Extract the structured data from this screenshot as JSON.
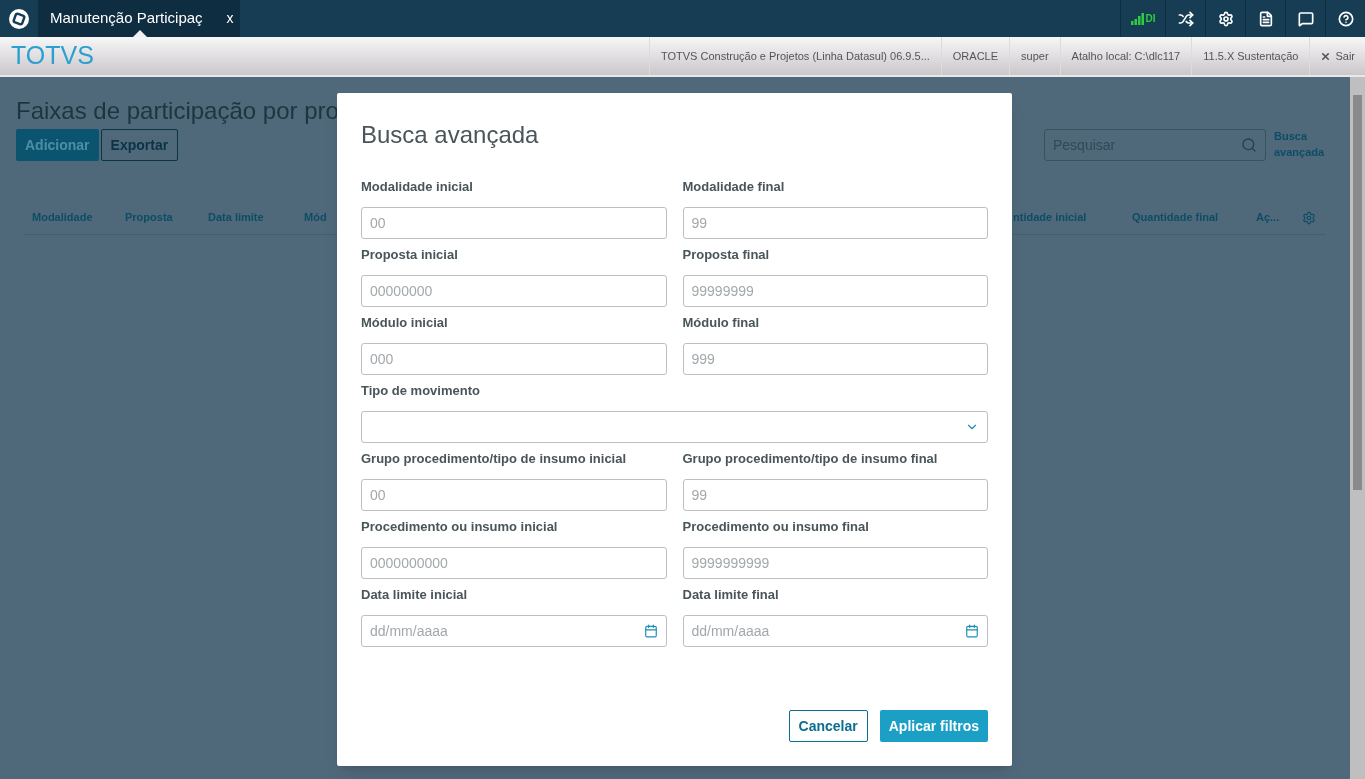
{
  "topbar": {
    "tab": {
      "title": "Manutenção Participaç",
      "close": "x",
      "selected": true
    },
    "connection": "DI"
  },
  "header": {
    "brand": "TOTVS",
    "info": [
      "TOTVS Construção e Projetos (Linha Datasul) 06.9.5...",
      "ORACLE",
      "super",
      "Atalho local: C:\\dlc117",
      "11.5.X Sustentação"
    ],
    "logout": "Sair"
  },
  "page": {
    "title": "Faixas de participação por pro",
    "buttons": [
      {
        "label": "Adicionar",
        "kind": "primary"
      },
      {
        "label": "Exportar",
        "kind": "secondary"
      }
    ],
    "search": {
      "placeholder": "Pesquisar"
    },
    "advanced_link": "Busca avançada",
    "columns_left": [
      "Modalidade",
      "Proposta",
      "Data limite",
      "Mód"
    ],
    "columns_right": [
      "ntidade inicial",
      "Quantidade final",
      "Aç..."
    ]
  },
  "dialog": {
    "title": "Busca avançada",
    "fields": [
      {
        "label": "Modalidade inicial",
        "placeholder": "00",
        "kind": "text"
      },
      {
        "label": "Modalidade final",
        "placeholder": "99",
        "kind": "text"
      },
      {
        "label": "Proposta inicial",
        "placeholder": "00000000",
        "kind": "text"
      },
      {
        "label": "Proposta final",
        "placeholder": "99999999",
        "kind": "text"
      },
      {
        "label": "Módulo inicial",
        "placeholder": "000",
        "kind": "text"
      },
      {
        "label": "Módulo final",
        "placeholder": "999",
        "kind": "text"
      },
      {
        "label": "Tipo de movimento",
        "kind": "select"
      },
      {
        "label": "Grupo procedimento/tipo de insumo inicial",
        "placeholder": "00",
        "kind": "text"
      },
      {
        "label": "Grupo procedimento/tipo de insumo final",
        "placeholder": "99",
        "kind": "text"
      },
      {
        "label": "Procedimento ou insumo inicial",
        "placeholder": "0000000000",
        "kind": "text"
      },
      {
        "label": "Procedimento ou insumo final",
        "placeholder": "9999999999",
        "kind": "text"
      },
      {
        "label": "Data limite inicial",
        "placeholder": "dd/mm/aaaa",
        "kind": "date"
      },
      {
        "label": "Data limite final",
        "placeholder": "dd/mm/aaaa",
        "kind": "date"
      }
    ],
    "buttons": [
      {
        "label": "Cancelar",
        "kind": "secondary"
      },
      {
        "label": "Aplicar filtros",
        "kind": "primary"
      }
    ]
  }
}
